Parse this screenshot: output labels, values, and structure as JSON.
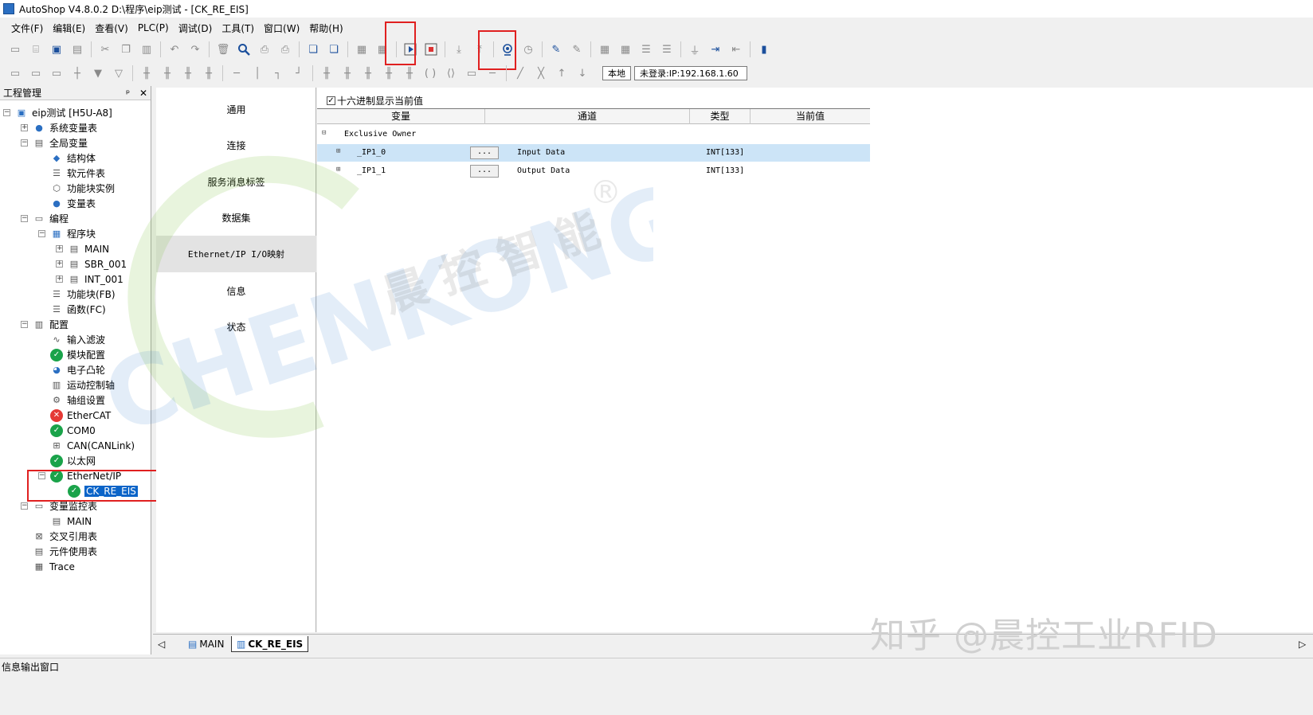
{
  "window": {
    "title": "AutoShop V4.8.0.2  D:\\程序\\eip测试 - [CK_RE_EIS]"
  },
  "menu": [
    "文件(F)",
    "编辑(E)",
    "查看(V)",
    "PLC(P)",
    "调试(D)",
    "工具(T)",
    "窗口(W)",
    "帮助(H)"
  ],
  "toolbar": {
    "mode_label": "本地",
    "login_status": "未登录:IP:192.168.1.60"
  },
  "project_panel": {
    "title": "工程管理",
    "pin": "ᵖ",
    "close": "✕",
    "tree": [
      {
        "label": "eip测试 [H5U-A8]",
        "icon": "computer-icon"
      },
      {
        "label": "系统变量表",
        "icon": "globe-icon"
      },
      {
        "label": "全局变量",
        "icon": "table-icon"
      },
      {
        "label": "结构体",
        "icon": "struct-icon"
      },
      {
        "label": "软元件表",
        "icon": "list-icon"
      },
      {
        "label": "功能块实例",
        "icon": "cube-icon"
      },
      {
        "label": "变量表",
        "icon": "globe-icon"
      },
      {
        "label": "编程",
        "icon": "program-icon"
      },
      {
        "label": "程序块",
        "icon": "grid-icon"
      },
      {
        "label": "MAIN",
        "icon": "page-icon"
      },
      {
        "label": "SBR_001",
        "icon": "page-icon"
      },
      {
        "label": "INT_001",
        "icon": "page-icon"
      },
      {
        "label": "功能块(FB)",
        "icon": "list-icon"
      },
      {
        "label": "函数(FC)",
        "icon": "list-icon"
      },
      {
        "label": "配置",
        "icon": "config-icon"
      },
      {
        "label": "输入滤波",
        "icon": "wave-icon"
      },
      {
        "label": "模块配置",
        "icon": "check-icon"
      },
      {
        "label": "电子凸轮",
        "icon": "cam-icon"
      },
      {
        "label": "运动控制轴",
        "icon": "axis-icon"
      },
      {
        "label": "轴组设置",
        "icon": "gear-icon"
      },
      {
        "label": "EtherCAT",
        "icon": "error-icon"
      },
      {
        "label": "COM0",
        "icon": "check-icon"
      },
      {
        "label": "CAN(CANLink)",
        "icon": "network-icon"
      },
      {
        "label": "以太网",
        "icon": "check-icon"
      },
      {
        "label": "EtherNet/IP",
        "icon": "check-icon"
      },
      {
        "label": "CK_RE_EIS",
        "icon": "check-icon"
      },
      {
        "label": "变量监控表",
        "icon": "monitor-icon"
      },
      {
        "label": "MAIN",
        "icon": "page-icon"
      },
      {
        "label": "交叉引用表",
        "icon": "cross-ref-icon"
      },
      {
        "label": "元件使用表",
        "icon": "db-icon"
      },
      {
        "label": "Trace",
        "icon": "trace-icon"
      }
    ]
  },
  "config_nav": [
    "通用",
    "连接",
    "服务消息标签",
    "数据集",
    "Ethernet/IP I/O映射",
    "信息",
    "状态"
  ],
  "io_mapping": {
    "hex_checkbox": "十六进制显示当前值",
    "hex_checked_mark": "✓",
    "columns": [
      "变量",
      "通道",
      "类型",
      "当前值"
    ],
    "group": "Exclusive Owner",
    "rows": [
      {
        "variable": "_IP1_0",
        "button": "...",
        "channel": "Input Data",
        "type": "INT[133]",
        "value": ""
      },
      {
        "variable": "_IP1_1",
        "button": "...",
        "channel": "Output Data",
        "type": "INT[133]",
        "value": ""
      }
    ]
  },
  "watermark": {
    "brand": "CHENKONG",
    "cn": "晨 控 智 能",
    "reg": "®"
  },
  "tabs": [
    "MAIN",
    "CK_RE_EIS"
  ],
  "status": "信息输出窗口",
  "credit": "知乎 @晨控工业RFID"
}
